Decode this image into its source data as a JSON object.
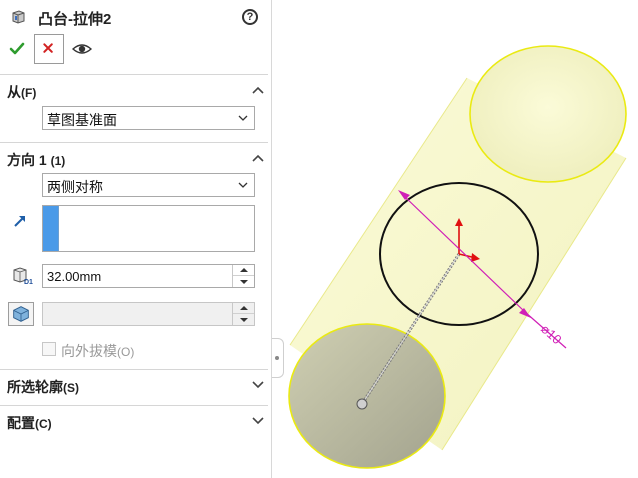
{
  "header": {
    "title": "凸台-拉伸2",
    "help_label": "?"
  },
  "actions": {
    "ok": "check-icon",
    "cancel": "close-icon",
    "preview": "eye-icon"
  },
  "from": {
    "title": "从",
    "title_suffix": "(F)",
    "start_condition": "草图基准面"
  },
  "direction1": {
    "title": "方向 1",
    "title_suffix": "(1)",
    "end_condition": "两侧对称",
    "depth_value": "32.00mm",
    "draft_value": "",
    "draft_outward_label": "向外拔模",
    "draft_outward_suffix": "(O)",
    "draft_outward_checked": false
  },
  "selected_contours": {
    "title": "所选轮廓",
    "title_suffix": "(S)"
  },
  "configurations": {
    "title": "配置",
    "title_suffix": "(C)"
  },
  "viewport": {
    "dimension_label": "⌀10"
  },
  "colors": {
    "accent": "#4a9ae8",
    "ok": "#2e9c2e",
    "cancel": "#d22222",
    "dimension": "#d01fb6",
    "cylinder": "#fbfbd2",
    "edge": "#eaea12"
  }
}
